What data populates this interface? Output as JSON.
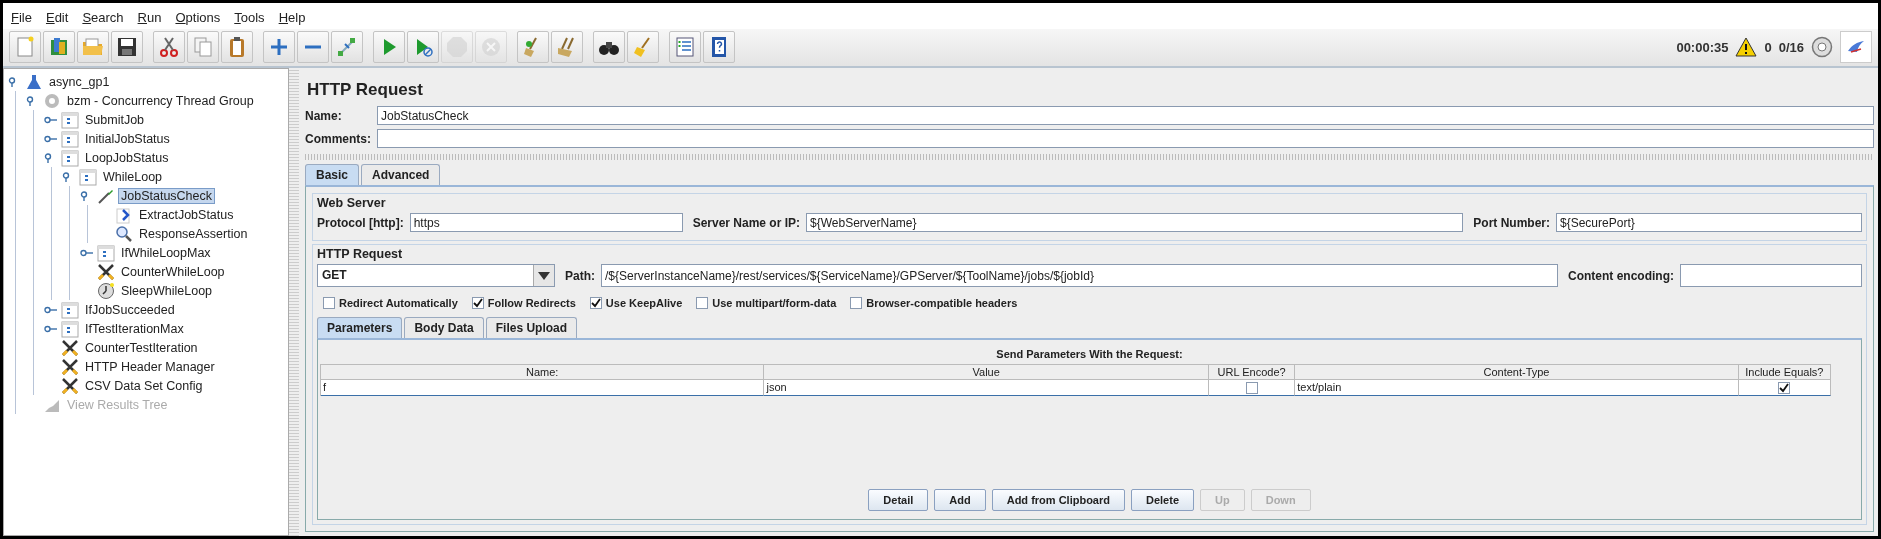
{
  "menu": [
    "File",
    "Edit",
    "Search",
    "Run",
    "Options",
    "Tools",
    "Help"
  ],
  "toolbar": [
    {
      "kind": "new",
      "disabled": false
    },
    {
      "kind": "templates",
      "disabled": false
    },
    {
      "kind": "open",
      "disabled": false
    },
    {
      "kind": "save",
      "disabled": false
    },
    {
      "kind": "cut",
      "disabled": false
    },
    {
      "kind": "copy",
      "disabled": false
    },
    {
      "kind": "paste",
      "disabled": false
    },
    {
      "kind": "expand",
      "disabled": false
    },
    {
      "kind": "collapse",
      "disabled": false
    },
    {
      "kind": "toggle",
      "disabled": false
    },
    {
      "kind": "start",
      "disabled": false
    },
    {
      "kind": "start-no-pause",
      "disabled": false
    },
    {
      "kind": "stop",
      "disabled": true
    },
    {
      "kind": "shutdown",
      "disabled": true
    },
    {
      "kind": "clear",
      "disabled": false
    },
    {
      "kind": "clear-all",
      "disabled": false
    },
    {
      "kind": "search",
      "disabled": false
    },
    {
      "kind": "reset-search",
      "disabled": false
    },
    {
      "kind": "functions",
      "disabled": false
    },
    {
      "kind": "help",
      "disabled": false
    }
  ],
  "status": {
    "elapsed": "00:00:35",
    "warnings": "0",
    "threads": "0/16"
  },
  "tree": [
    {
      "label": "async_gp1",
      "kind": "testplan",
      "expanded": true,
      "selected": false,
      "disabled": false,
      "children": [
        {
          "label": "bzm - Concurrency Thread Group",
          "kind": "threadgroup",
          "expanded": true,
          "selected": false,
          "disabled": false,
          "children": [
            {
              "label": "SubmitJob",
              "kind": "controller",
              "expanded": false,
              "selected": false,
              "disabled": false
            },
            {
              "label": "InitialJobStatus",
              "kind": "controller",
              "expanded": false,
              "selected": false,
              "disabled": false
            },
            {
              "label": "LoopJobStatus",
              "kind": "controller",
              "expanded": true,
              "selected": false,
              "disabled": false,
              "children": [
                {
                  "label": "WhileLoop",
                  "kind": "controller",
                  "expanded": true,
                  "selected": false,
                  "disabled": false,
                  "children": [
                    {
                      "label": "JobStatusCheck",
                      "kind": "sampler",
                      "expanded": true,
                      "selected": true,
                      "disabled": false,
                      "children": [
                        {
                          "label": "ExtractJobStatus",
                          "kind": "extractor",
                          "selected": false,
                          "disabled": false
                        },
                        {
                          "label": "ResponseAssertion",
                          "kind": "assertion",
                          "selected": false,
                          "disabled": false
                        }
                      ]
                    },
                    {
                      "label": "IfWhileLoopMax",
                      "kind": "controller",
                      "expanded": false,
                      "selected": false,
                      "disabled": false
                    },
                    {
                      "label": "CounterWhileLoop",
                      "kind": "config",
                      "selected": false,
                      "disabled": false
                    },
                    {
                      "label": "SleepWhileLoop",
                      "kind": "timer",
                      "selected": false,
                      "disabled": false
                    }
                  ]
                }
              ]
            },
            {
              "label": "IfJobSucceeded",
              "kind": "controller",
              "expanded": false,
              "selected": false,
              "disabled": false
            },
            {
              "label": "IfTestIterationMax",
              "kind": "controller",
              "expanded": false,
              "selected": false,
              "disabled": false
            },
            {
              "label": "CounterTestIteration",
              "kind": "config",
              "selected": false,
              "disabled": false
            },
            {
              "label": "HTTP Header Manager",
              "kind": "config",
              "selected": false,
              "disabled": false
            },
            {
              "label": "CSV Data Set Config",
              "kind": "config",
              "selected": false,
              "disabled": false
            }
          ]
        },
        {
          "label": "View Results Tree",
          "kind": "listener",
          "selected": false,
          "disabled": true
        }
      ]
    }
  ],
  "editor": {
    "title": "HTTP Request",
    "name_label": "Name:",
    "name": "JobStatusCheck",
    "comments_label": "Comments:",
    "tabs": [
      {
        "label": "Basic",
        "selected": true
      },
      {
        "label": "Advanced",
        "selected": false
      }
    ],
    "web_server": {
      "title": "Web Server",
      "protocol_label": "Protocol [http]:",
      "protocol": "https",
      "server_label": "Server Name or IP:",
      "server": "${WebServerName}",
      "port_label": "Port Number:",
      "port": "${SecurePort}"
    },
    "http_request": {
      "title": "HTTP Request",
      "method": "GET",
      "path_label": "Path:",
      "path": "/${ServerInstanceName}/rest/services/${ServiceName}/GPServer/${ToolName}/jobs/${jobId}",
      "encoding_label": "Content encoding:"
    },
    "options": [
      {
        "label": "Redirect Automatically",
        "checked": false
      },
      {
        "label": "Follow Redirects",
        "checked": true
      },
      {
        "label": "Use KeepAlive",
        "checked": true
      },
      {
        "label": "Use multipart/form-data",
        "checked": false
      },
      {
        "label": "Browser-compatible headers",
        "checked": false
      }
    ],
    "param_tabs": [
      {
        "label": "Parameters",
        "selected": true
      },
      {
        "label": "Body Data",
        "selected": false
      },
      {
        "label": "Files Upload",
        "selected": false
      }
    ],
    "params": {
      "title": "Send Parameters With the Request:",
      "columns": [
        "Name:",
        "Value",
        "URL Encode?",
        "Content-Type",
        "Include Equals?"
      ],
      "rows": [
        {
          "name": "f",
          "value": "json",
          "url_encode": false,
          "content_type": "text/plain",
          "include_equals": true
        }
      ]
    },
    "buttons": [
      {
        "label": "Detail",
        "disabled": false
      },
      {
        "label": "Add",
        "disabled": false
      },
      {
        "label": "Add from Clipboard",
        "disabled": false
      },
      {
        "label": "Delete",
        "disabled": false
      },
      {
        "label": "Up",
        "disabled": true
      },
      {
        "label": "Down",
        "disabled": true
      }
    ]
  }
}
